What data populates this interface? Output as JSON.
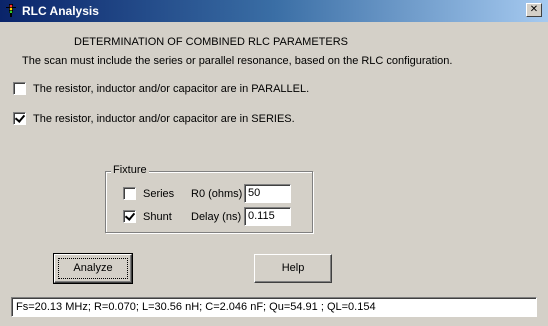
{
  "window": {
    "title": "RLC Analysis",
    "close_glyph": "✕",
    "icon": "app-icon",
    "title_gradient": [
      "#0a246a",
      "#a6caf0"
    ]
  },
  "header": {
    "heading": "DETERMINATION OF COMBINED RLC PARAMETERS",
    "subheading": "The scan must include the series or parallel resonance, based on the RLC configuration."
  },
  "configuration": {
    "parallel": {
      "label": "The resistor, inductor and/or capacitor are in PARALLEL.",
      "checked": false
    },
    "series": {
      "label": "The resistor, inductor and/or capacitor are in SERIES.",
      "checked": true
    }
  },
  "fixture": {
    "legend": "Fixture",
    "series": {
      "label": "Series",
      "checked": false
    },
    "shunt": {
      "label": "Shunt",
      "checked": true
    },
    "r0": {
      "label": "R0 (ohms)",
      "value": "50"
    },
    "delay": {
      "label": "Delay (ns)",
      "value": "0.115"
    }
  },
  "buttons": {
    "analyze": "Analyze",
    "help": "Help"
  },
  "result": {
    "text": "Fs=20.13 MHz; R=0.070; L=30.56 nH; C=2.046 nF; Qu=54.91 ; QL=0.154"
  }
}
